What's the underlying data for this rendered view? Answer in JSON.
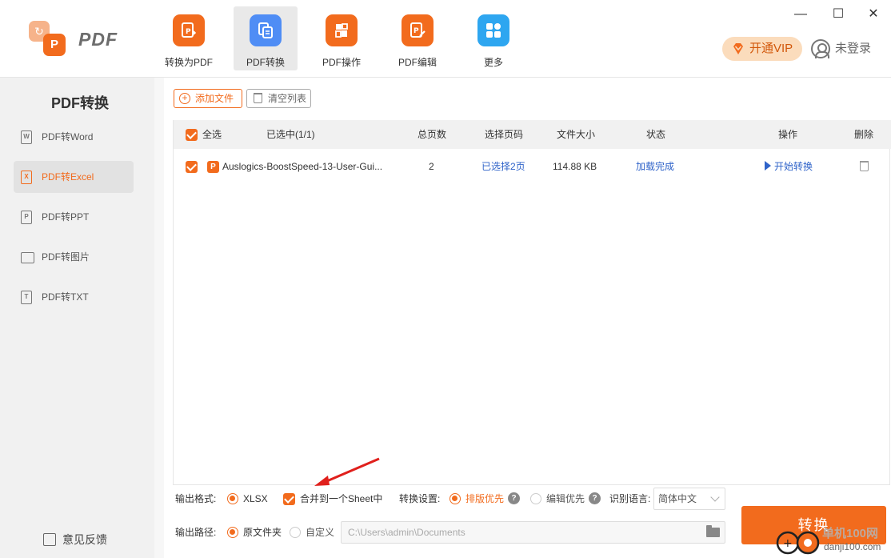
{
  "app": {
    "logo_text": "PDF"
  },
  "tabs": [
    {
      "label": "转换为PDF",
      "color": "#f26b1d",
      "active": false
    },
    {
      "label": "PDF转换",
      "color": "#4f8df5",
      "active": true
    },
    {
      "label": "PDF操作",
      "color": "#f26b1d",
      "active": false
    },
    {
      "label": "PDF编辑",
      "color": "#f26b1d",
      "active": false
    },
    {
      "label": "更多",
      "color": "#2ea6f0",
      "active": false
    }
  ],
  "window": {
    "minimize": "—",
    "maximize": "☐",
    "close": "✕"
  },
  "header": {
    "vip_label": "开通VIP",
    "login_label": "未登录"
  },
  "sidebar": {
    "title": "PDF转换",
    "items": [
      {
        "label": "PDF转Word",
        "icon_letter": "W",
        "active": false
      },
      {
        "label": "PDF转Excel",
        "icon_letter": "X",
        "active": true
      },
      {
        "label": "PDF转PPT",
        "icon_letter": "P",
        "active": false
      },
      {
        "label": "PDF转图片",
        "icon_letter": "",
        "active": false
      },
      {
        "label": "PDF转TXT",
        "icon_letter": "T",
        "active": false
      }
    ],
    "feedback_label": "意见反馈"
  },
  "toolbar": {
    "add_label": "添加文件",
    "clear_label": "清空列表"
  },
  "table": {
    "headers": {
      "select_all": "全选",
      "selected": "已选中(1/1)",
      "pages": "总页数",
      "page_select": "选择页码",
      "size": "文件大小",
      "status": "状态",
      "action": "操作",
      "delete": "删除"
    },
    "rows": [
      {
        "checked": true,
        "file_badge": "P",
        "name": "Auslogics-BoostSpeed-13-User-Gui...",
        "pages": "2",
        "page_select": "已选择2页",
        "size": "114.88 KB",
        "status": "加载完成",
        "action": "开始转换"
      }
    ]
  },
  "options": {
    "format_label": "输出格式:",
    "format_value": "XLSX",
    "merge_label": "合并到一个Sheet中",
    "merge_checked": true,
    "convert_setting_label": "转换设置:",
    "layout_first": "排版优先",
    "edit_first": "编辑优先",
    "help_glyph": "?",
    "lang_label": "识别语言:",
    "lang_value": "简体中文",
    "path_label": "输出路径:",
    "path_original": "原文件夹",
    "path_custom": "自定义",
    "path_value": "C:\\Users\\admin\\Documents",
    "convert_button": "转换"
  },
  "watermark": {
    "text": "单机100网",
    "url": "danji100.com"
  },
  "colors": {
    "accent": "#f26b1d",
    "link": "#2f63c9",
    "annotation_arrow": "#e0201c"
  }
}
